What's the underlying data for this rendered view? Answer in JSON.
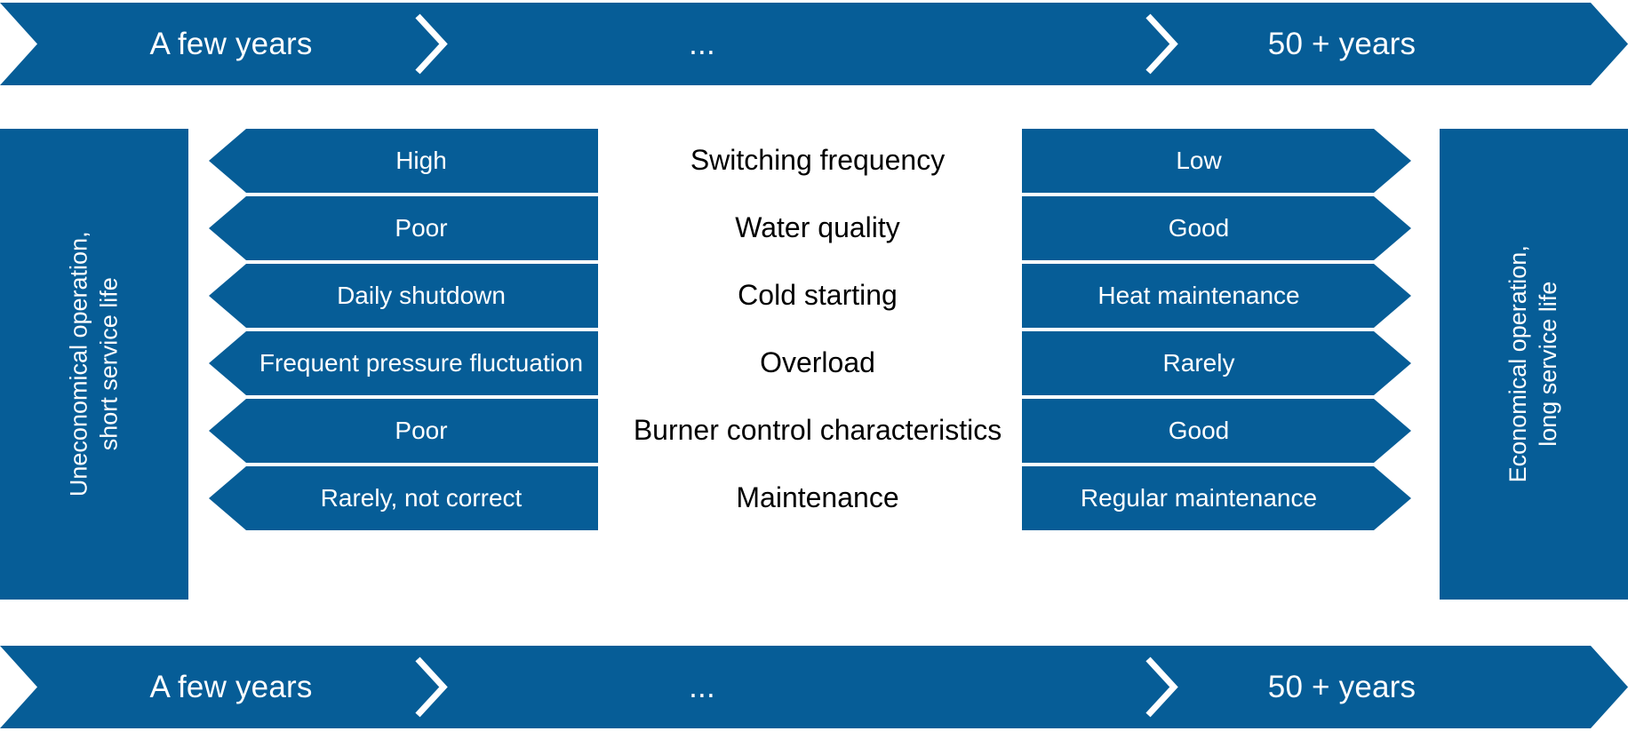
{
  "timeline": {
    "top": {
      "start_label": "A few years",
      "middle_label": "...",
      "end_label": "50 + years"
    },
    "bottom": {
      "start_label": "A few years",
      "middle_label": "...",
      "end_label": "50 + years"
    }
  },
  "side_panels": {
    "left": {
      "line1": "Uneconomical operation,",
      "line2": "short service life"
    },
    "right": {
      "line1": "Economical operation,",
      "line2": "long service life"
    }
  },
  "comparison": {
    "rows": [
      {
        "left": "High",
        "criterion": "Switching frequency",
        "right": "Low"
      },
      {
        "left": "Poor",
        "criterion": "Water quality",
        "right": "Good"
      },
      {
        "left": "Daily shutdown",
        "criterion": "Cold starting",
        "right": "Heat maintenance"
      },
      {
        "left": "Frequent pressure fluctuation",
        "criterion": "Overload",
        "right": "Rarely"
      },
      {
        "left": "Poor",
        "criterion": "Burner control characteristics",
        "right": "Good"
      },
      {
        "left": "Rarely, not correct",
        "criterion": "Maintenance",
        "right": "Regular maintenance"
      }
    ]
  },
  "colors": {
    "brand_blue": "#065d97",
    "text_on_blue": "#ffffff",
    "criterion_text": "#000000",
    "background": "#ffffff"
  }
}
